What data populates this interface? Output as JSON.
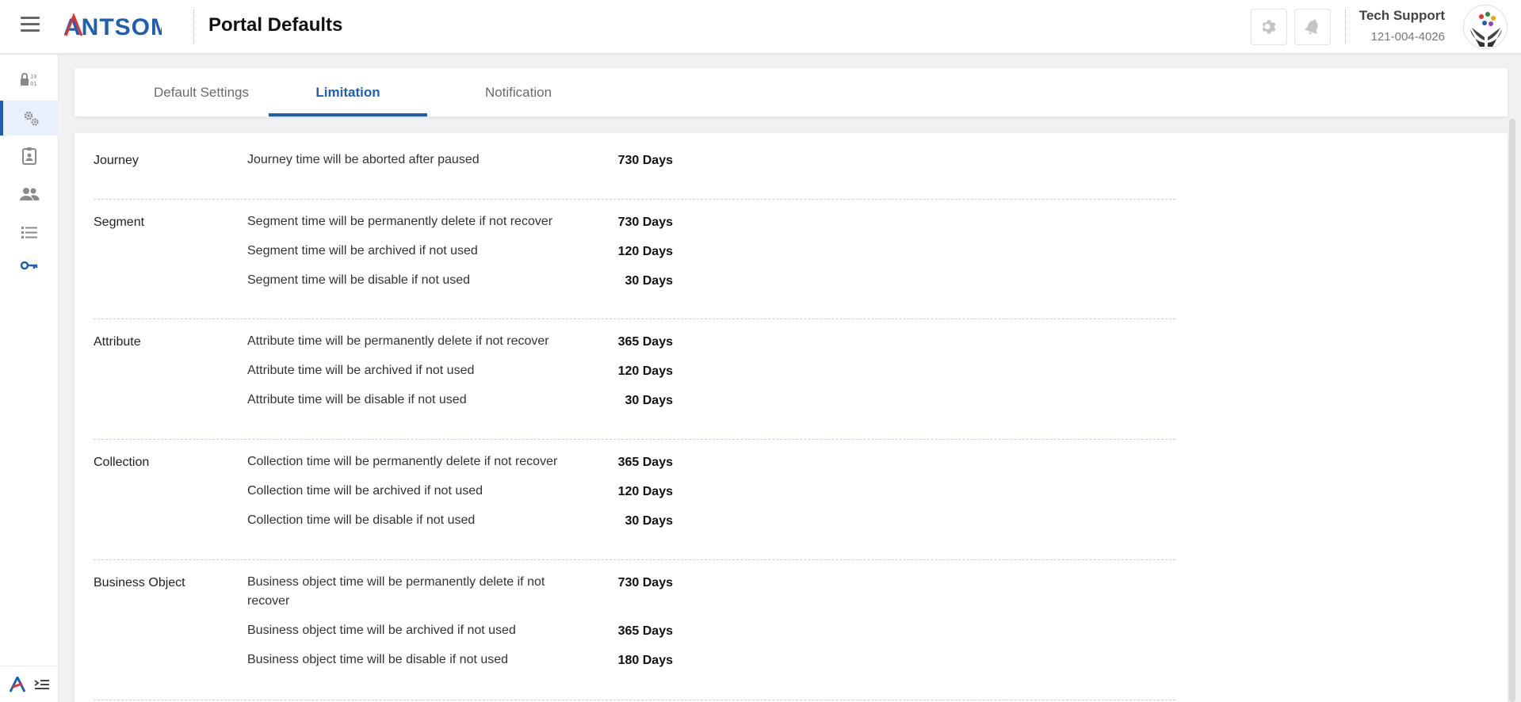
{
  "header": {
    "logo_text": "ANTSOMI",
    "title": "Portal Defaults",
    "settings_icon": "gear-icon",
    "bell_icon": "bell-icon",
    "user_name": "Tech Support",
    "user_phone": "121-004-4026",
    "brand_color": "#1f5fb3"
  },
  "sidebar": {
    "items": [
      {
        "icon": "lock-binary-icon"
      },
      {
        "icon": "gears-icon"
      },
      {
        "icon": "badge-icon"
      },
      {
        "icon": "users-icon"
      },
      {
        "icon": "list-icon"
      },
      {
        "icon": "key-icon"
      }
    ],
    "active_index": 1
  },
  "tabs": [
    {
      "label": "Default Settings"
    },
    {
      "label": "Limitation"
    },
    {
      "label": "Notification"
    }
  ],
  "active_tab": "Limitation",
  "sections": [
    {
      "title": "Journey",
      "rows": [
        {
          "desc": "Journey time will be aborted after paused",
          "value": "730 Days"
        }
      ]
    },
    {
      "title": "Segment",
      "rows": [
        {
          "desc": "Segment time will be permanently delete if not recover",
          "value": "730 Days"
        },
        {
          "desc": "Segment time will be archived if not used",
          "value": "120 Days"
        },
        {
          "desc": "Segment time will be disable if not used",
          "value": "30 Days"
        }
      ]
    },
    {
      "title": "Attribute",
      "rows": [
        {
          "desc": "Attribute time will be permanently delete if not recover",
          "value": "365 Days"
        },
        {
          "desc": "Attribute time will be archived if not used",
          "value": "120 Days"
        },
        {
          "desc": "Attribute time will be disable if not used",
          "value": "30 Days"
        }
      ]
    },
    {
      "title": "Collection",
      "rows": [
        {
          "desc": "Collection time will be permanently delete if not recover",
          "value": "365 Days"
        },
        {
          "desc": "Collection time will be archived if not used",
          "value": "120 Days"
        },
        {
          "desc": "Collection time will be disable if not used",
          "value": "30 Days"
        }
      ]
    },
    {
      "title": "Business Object",
      "rows": [
        {
          "desc": "Business object time will be permanently delete if not recover",
          "value": "730 Days"
        },
        {
          "desc": "Business object time will be archived if not used",
          "value": "365 Days"
        },
        {
          "desc": "Business object time will be disable if not used",
          "value": "180 Days"
        }
      ]
    }
  ]
}
